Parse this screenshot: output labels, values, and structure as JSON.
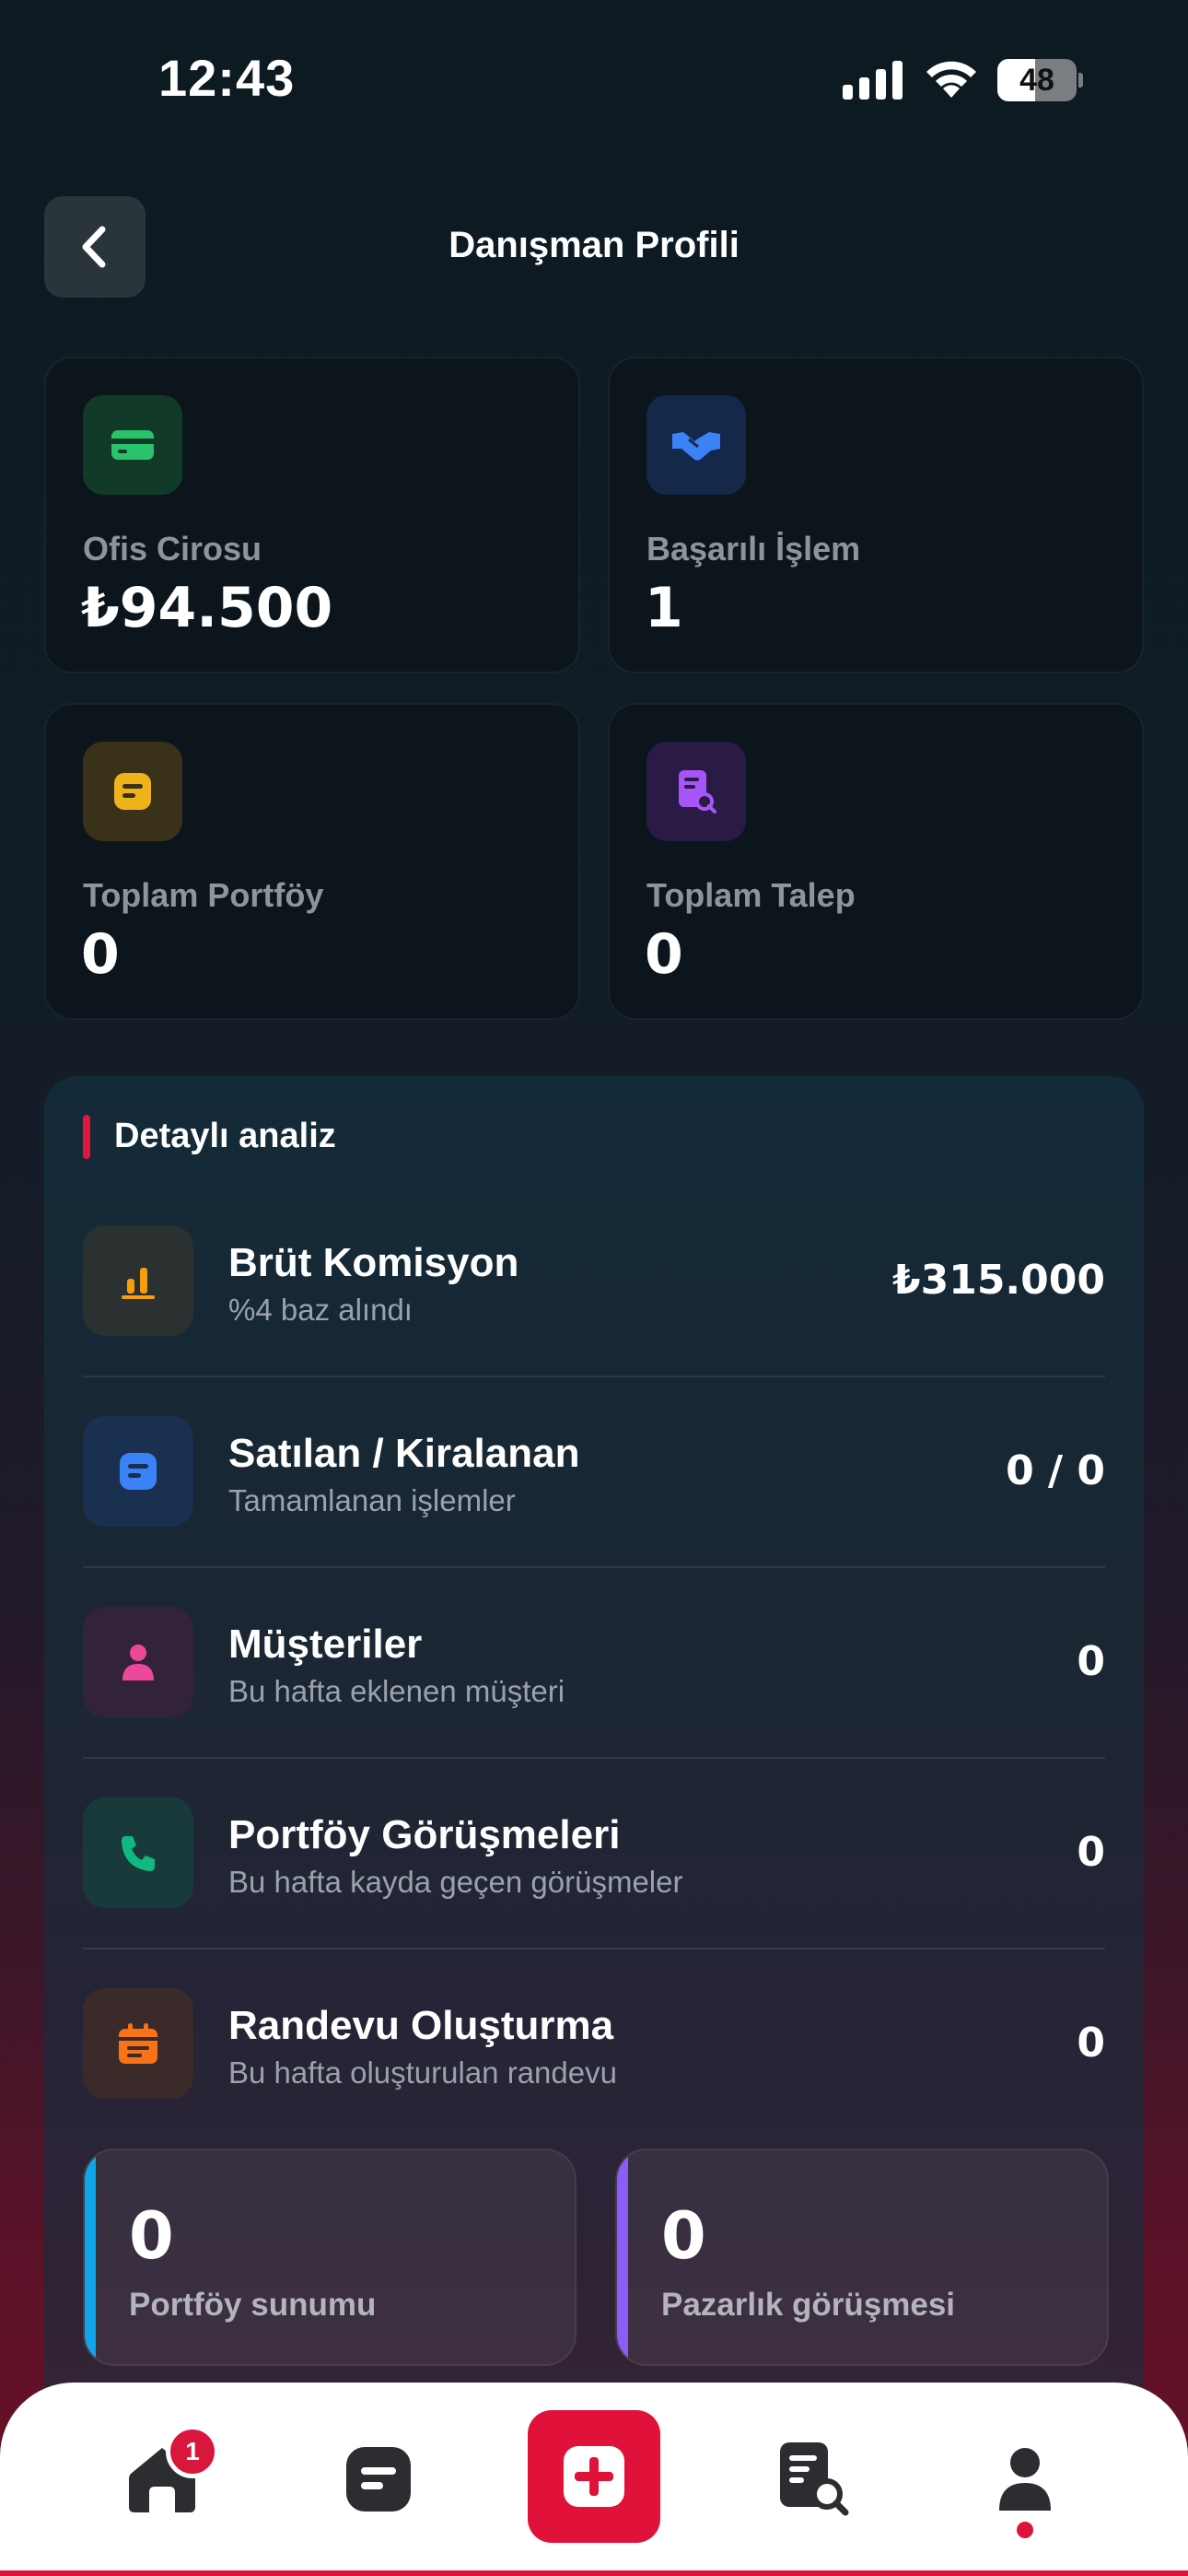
{
  "status_bar": {
    "time": "12:43",
    "battery": "48",
    "battery_level": 0.48
  },
  "header": {
    "title": "Danışman Profili"
  },
  "stats": [
    {
      "label": "Ofis Cirosu",
      "value": "₺94.500",
      "icon": "credit-card-icon",
      "color": "#2ac26b"
    },
    {
      "label": "Başarılı İşlem",
      "value": "1",
      "icon": "handshake-icon",
      "color": "#3b82f6"
    },
    {
      "label": "Toplam Portföy",
      "value": "0",
      "icon": "note-icon",
      "color": "#f1b31a"
    },
    {
      "label": "Toplam Talep",
      "value": "0",
      "icon": "document-search-icon",
      "color": "#a855f7"
    }
  ],
  "analysis": {
    "title": "Detaylı analiz",
    "rows": [
      {
        "title": "Brüt Komisyon",
        "subtitle": "%4 baz alındı",
        "value": "₺315.000",
        "icon": "bar-chart-icon",
        "color": "#f59e0b"
      },
      {
        "title": "Satılan / Kiralanan",
        "subtitle": "Tamamlanan işlemler",
        "value": "0 / 0",
        "icon": "note-icon",
        "color": "#3b82f6"
      },
      {
        "title": "Müşteriler",
        "subtitle": "Bu hafta eklenen müşteri",
        "value": "0",
        "icon": "person-icon",
        "color": "#ec4899"
      },
      {
        "title": "Portföy Görüşmeleri",
        "subtitle": "Bu hafta kayda geçen görüşmeler",
        "value": "0",
        "icon": "phone-icon",
        "color": "#10b981"
      },
      {
        "title": "Randevu Oluşturma",
        "subtitle": "Bu hafta oluşturulan randevu",
        "value": "0",
        "icon": "calendar-icon",
        "color": "#f97316"
      }
    ],
    "mini_cards": [
      {
        "value": "0",
        "label": "Portföy sunumu",
        "color": "#0ea5e9"
      },
      {
        "value": "0",
        "label": "Pazarlık görüşmesi",
        "color": "#8b5cf6"
      }
    ]
  },
  "nav": {
    "items": [
      "home-icon",
      "note-icon",
      "add-icon",
      "document-search-icon",
      "person-icon"
    ],
    "home_badge": "1",
    "active": "profile"
  }
}
